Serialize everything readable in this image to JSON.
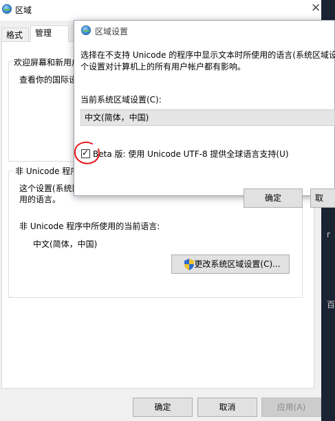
{
  "region_window": {
    "title": "区域",
    "tabs": [
      {
        "label": "格式"
      },
      {
        "label": "管理"
      }
    ],
    "welcome_group": {
      "title": "欢迎屏幕和新用户",
      "text": "查看你的国际设"
    },
    "unicode_group": {
      "title": "非 Unicode 程序",
      "description": "这个设置(系统区域设置)控制显示文本时使用的语言。",
      "description_visible": "这个设置(系统区\n用的语言。",
      "current_label": "非 Unicode 程序中所使用的当前语言:",
      "current_value": "中文(简体，中国)",
      "change_button": "更改系统区域设置(C)..."
    },
    "buttons": {
      "ok": "确定",
      "cancel": "取消",
      "apply": "应用(A)"
    }
  },
  "dialog": {
    "title": "区域设置",
    "description_line1": "选择在不支持 Unicode 的程序中显示文本时所使用的语言(系统区域设",
    "description_line2": "个设置对计算机上的所有用户帐户都有影响。",
    "current_label": "当前系统区域设置(C):",
    "current_value": "中文(简体，中国)",
    "beta_checkbox_label": "Beta 版: 使用 Unicode UTF-8 提供全球语言支持(U)",
    "beta_checked": true,
    "ok": "确定",
    "cancel": "取"
  },
  "background": {
    "glyphs": [
      "r",
      "百"
    ]
  },
  "colors": {
    "window_bg": "#f0f0f0",
    "annotation_red": "#e8161b",
    "desktop_bg": "#1b2433"
  }
}
